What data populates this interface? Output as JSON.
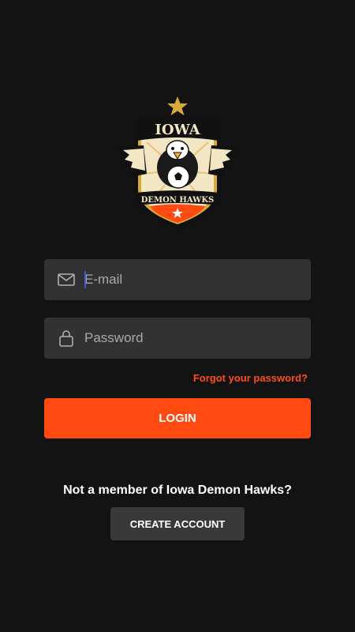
{
  "logo": {
    "top_text": "IOWA",
    "bottom_text": "DEMON HAWKS",
    "colors": {
      "gold": "#d9a93a",
      "cream": "#f3e6c4",
      "orange": "#ff4a12",
      "black": "#111111"
    }
  },
  "login_form": {
    "email_placeholder": "E-mail",
    "email_icon": "mail-icon",
    "password_placeholder": "Password",
    "password_icon": "lock-icon",
    "forgot_password_link": "Forgot your password?",
    "login_button": "LOGIN"
  },
  "signup": {
    "prompt": "Not a member of Iowa Demon Hawks?",
    "create_account_button": "CREATE ACCOUNT"
  },
  "colors": {
    "background": "#141313",
    "field_background": "#333232",
    "accent": "#ff4a12",
    "secondary_button": "#3a3939"
  }
}
